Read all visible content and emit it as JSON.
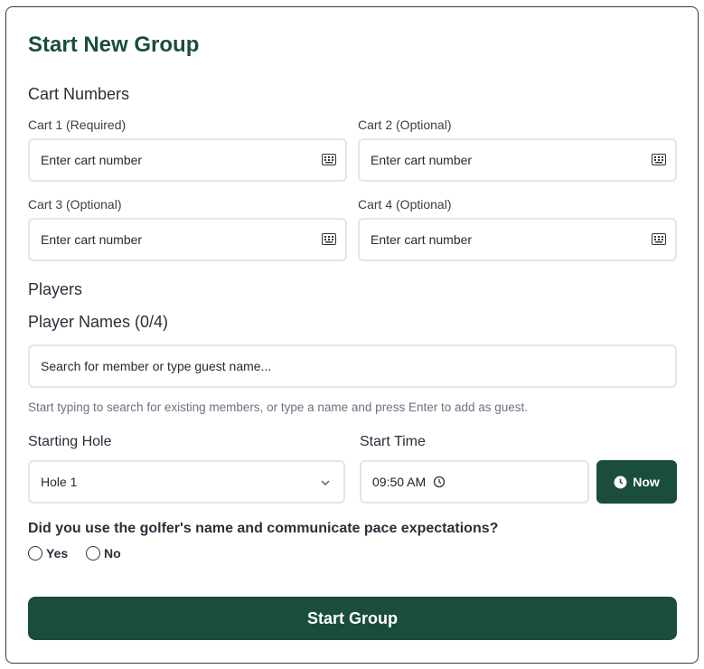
{
  "form": {
    "title": "Start New Group",
    "cart_section": "Cart Numbers",
    "carts": [
      {
        "label": "Cart 1 (Required)",
        "placeholder": "Enter cart number"
      },
      {
        "label": "Cart 2 (Optional)",
        "placeholder": "Enter cart number"
      },
      {
        "label": "Cart 3 (Optional)",
        "placeholder": "Enter cart number"
      },
      {
        "label": "Cart 4 (Optional)",
        "placeholder": "Enter cart number"
      }
    ],
    "players_section": "Players",
    "player_names_label": "Player Names (0/4)",
    "player_search_placeholder": "Search for member or type guest name...",
    "player_help": "Start typing to search for existing members, or type a name and press Enter to add as guest.",
    "starting_hole_label": "Starting Hole",
    "starting_hole_value": "Hole 1",
    "start_time_label": "Start Time",
    "start_time_value": "09:50 AM",
    "now_button": "Now",
    "question": "Did you use the golfer's name and communicate pace expectations?",
    "yes_label": "Yes",
    "no_label": "No",
    "submit_button": "Start Group"
  },
  "colors": {
    "accent": "#1b4d3e",
    "border": "#e3e5e8",
    "help_text": "#6b7280"
  },
  "icons": [
    "keyboard-icon",
    "chevron-down-icon",
    "clock-icon"
  ]
}
